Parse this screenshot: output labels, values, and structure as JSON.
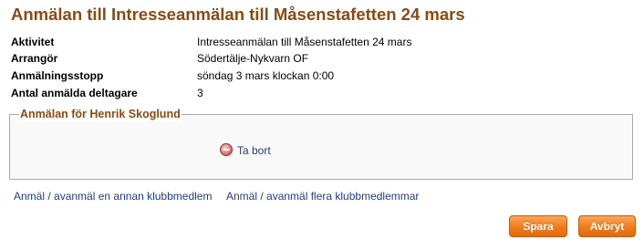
{
  "page": {
    "title": "Anmälan till Intresseanmälan till Måsenstafetten 24 mars"
  },
  "event_info": [
    {
      "label": "Aktivitet",
      "value": "Intresseanmälan till Måsenstafetten 24 mars"
    },
    {
      "label": "Arrangör",
      "value": "Södertälje-Nykvarn OF"
    },
    {
      "label": "Anmälningsstopp",
      "value": "söndag 3 mars klockan 0:00"
    },
    {
      "label": "Antal anmälda deltagare",
      "value": "3"
    }
  ],
  "registration": {
    "legend": "Anmälan för Henrik Skoglund",
    "remove_label": "Ta bort",
    "remove_icon": "remove-circle-icon"
  },
  "links": {
    "register_other": "Anmäl / avanmäl en annan klubbmedlem",
    "register_multiple": "Anmäl / avanmäl flera klubbmedlemmar"
  },
  "buttons": {
    "save_label": "Spara",
    "cancel_label": "Avbryt"
  },
  "colors": {
    "title": "#8c4a11",
    "link": "#1c3b9c",
    "button": "#ef7c1c"
  }
}
